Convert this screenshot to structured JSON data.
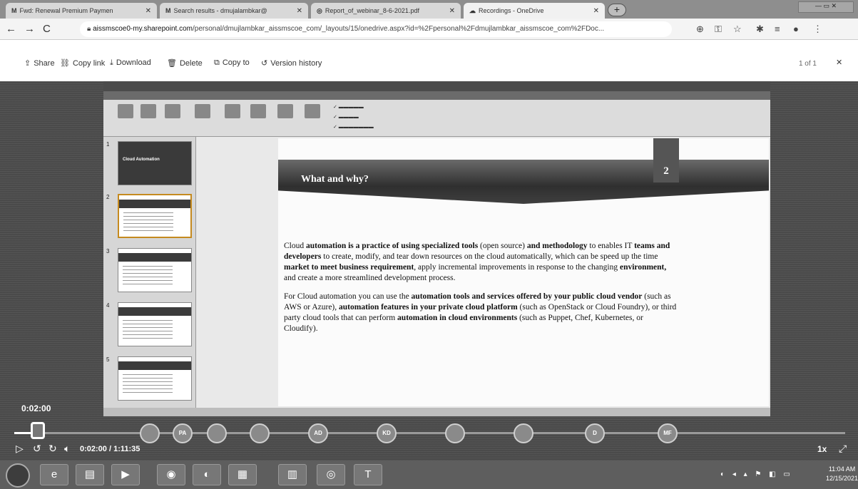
{
  "browser": {
    "tabs": [
      {
        "icon": "M",
        "label": "Fwd: Renewal Premium Paymen"
      },
      {
        "icon": "M",
        "label": "Search results - dmujalambkar@"
      },
      {
        "icon": "◎",
        "label": "Report_of_webinar_8-6-2021.pdf"
      },
      {
        "icon": "☁",
        "label": "Recordings - OneDrive"
      }
    ],
    "new_tab": "+",
    "url_host": "aissmscoe0-my.sharepoint.com",
    "url_path": "/personal/dmujlambkar_aissmscoe_com/_layouts/15/onedrive.aspx?id=%2Fpersonal%2Fdmujlambkar_aissmscoe_com%2FDoc..."
  },
  "commands": {
    "share": "Share",
    "copy_link": "Copy link",
    "download": "Download",
    "delete": "Delete",
    "copy_to": "Copy to",
    "version_history": "Version history",
    "pager": "1 of 1"
  },
  "slide": {
    "title": "What and why?",
    "number": "2",
    "para1_a": "Cloud ",
    "para1_b": "automation is a practice of using specialized tools",
    "para1_c": " (open source) ",
    "para1_d": "and methodology",
    "para1_e": " to enables IT ",
    "para1_f": "teams and developers",
    "para1_g": " to create, modify, and tear down resources on the cloud automatically, which can be speed up the time ",
    "para1_h": "market to meet business requirement",
    "para1_i": ", apply incremental improvements in response to the changing ",
    "para1_j": "environment,",
    "para1_k": " and create a more streamlined development process.",
    "para2_a": "For Cloud automation you can use the ",
    "para2_b": "automation tools and services offered by your public cloud vendor",
    "para2_c": " (such as AWS or Azure), ",
    "para2_d": "automation features in your private cloud platform",
    "para2_e": " (such as OpenStack or Cloud Foundry), or third party cloud tools that can perform ",
    "para2_f": "automation in cloud environments",
    "para2_g": " (such as Puppet, Chef, Kubernetes, or Cloudify)."
  },
  "thumbnails": [
    {
      "num": "1",
      "caption": "Cloud Automation"
    },
    {
      "num": "2"
    },
    {
      "num": "3"
    },
    {
      "num": "4"
    },
    {
      "num": "5"
    }
  ],
  "player": {
    "elapsed_overlay": "0:02:00",
    "timecode": "0:02:00 / 1:11:35",
    "progress": 0.028,
    "speed": "1x",
    "participants": [
      "",
      "PA",
      "",
      "",
      "AD",
      "KD",
      "",
      "",
      "D",
      "MF"
    ]
  },
  "taskbar": {
    "time": "11:04 AM",
    "date": "12/15/2021"
  }
}
